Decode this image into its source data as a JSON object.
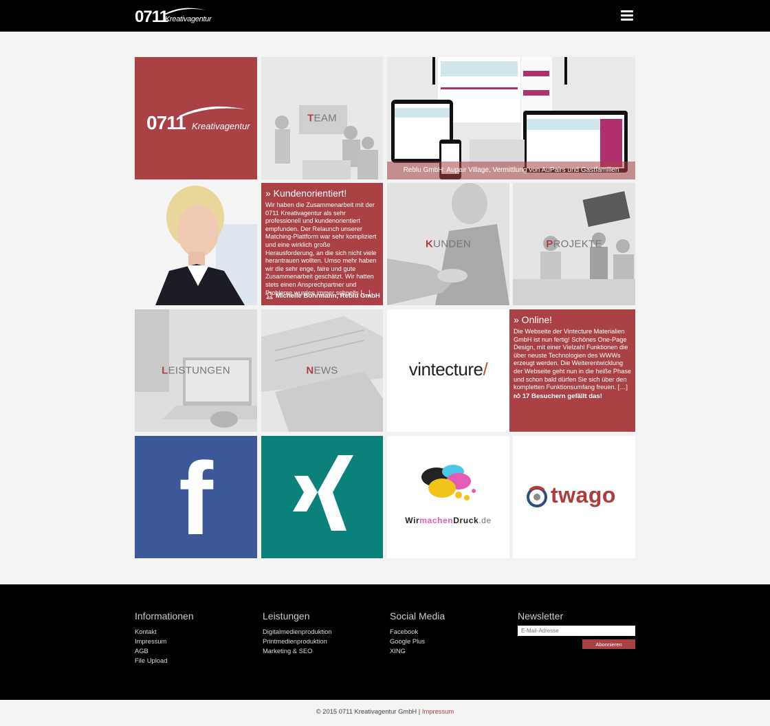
{
  "header": {
    "logo_number": "0711",
    "logo_word": "Kreativagentur"
  },
  "tiles": {
    "brand_tile": {
      "number": "0711",
      "word": "Kreativagentur"
    },
    "team": {
      "first": "T",
      "rest": "EAM"
    },
    "reblu": {
      "caption": "Reblu GmbH: Aupair Village, Vermittlung von AuPairs und Gastfamilien"
    },
    "testimonial": {
      "title": "» Kundenorientiert!",
      "text": "Wir haben die Zusammenarbeit mit der 0711 Kreativagentur als sehr professionell und kundenorientiert empfunden. Der Relaunch unserer Matching-Plattform war sehr kompliziert und eine wirklich große Herausforderung, an die sich nicht viele herantrauen wollten. Umso mehr haben wir die sehr enge, faire und gute Zusammenarbeit geschätzt. Wir hatten stets einen Ansprechpartner und Probleme wurden immer schnells […]",
      "author": "Michelle Bohrmann, Reblu GmbH"
    },
    "kunden": {
      "first": "K",
      "rest": "UNDEN"
    },
    "projekte": {
      "first": "P",
      "rest": "ROJEKTE"
    },
    "leistungen": {
      "first": "L",
      "rest": "EISTUNGEN"
    },
    "news": {
      "first": "N",
      "rest": "EWS"
    },
    "vintecture": {
      "text": "vintecture",
      "slash": "/"
    },
    "online": {
      "title": "» Online!",
      "text": "Die Webseite der Vintecture Materialien GmbH ist nun fertig! Schönes One-Page Design, mit einer Vielzahl Funktionen die über neuste Technologien des WWWs erzeugt werden. Die Weiterentwicklung der Webseite geht nun in die heiße Phase und schon bald dürfen Sie sich über den kompletten Funktionsumfang freuen. […]",
      "likes": "17 Besuchern gefällt das!"
    },
    "facebook": {
      "letter": "f"
    },
    "wmd": {
      "part1": "Wir",
      "part2": "machen",
      "part3": "Druck",
      "part4": ".de"
    },
    "twago": {
      "text": "twago"
    }
  },
  "footer": {
    "informationen": {
      "title": "Informationen",
      "links": [
        "Kontakt",
        "Impressum",
        "AGB",
        "File Upload"
      ]
    },
    "leistungen": {
      "title": "Leistungen",
      "links": [
        "Digitalmedienproduktion",
        "Printmedienproduktion",
        "Marketing & SEO"
      ]
    },
    "social": {
      "title": "Social Media",
      "links": [
        "Facebook",
        "Google Plus",
        "XING"
      ]
    },
    "newsletter": {
      "title": "Newsletter",
      "placeholder": "E-Mail-Adresse",
      "button": "Abonnieren"
    }
  },
  "copyright": {
    "text": "© 2015 0711 Kreativagentur GmbH |",
    "link": "Impressum"
  },
  "colors": {
    "accent": "#a94145",
    "facebook": "#3b5998",
    "xing": "#0a8279",
    "black": "#000000"
  }
}
